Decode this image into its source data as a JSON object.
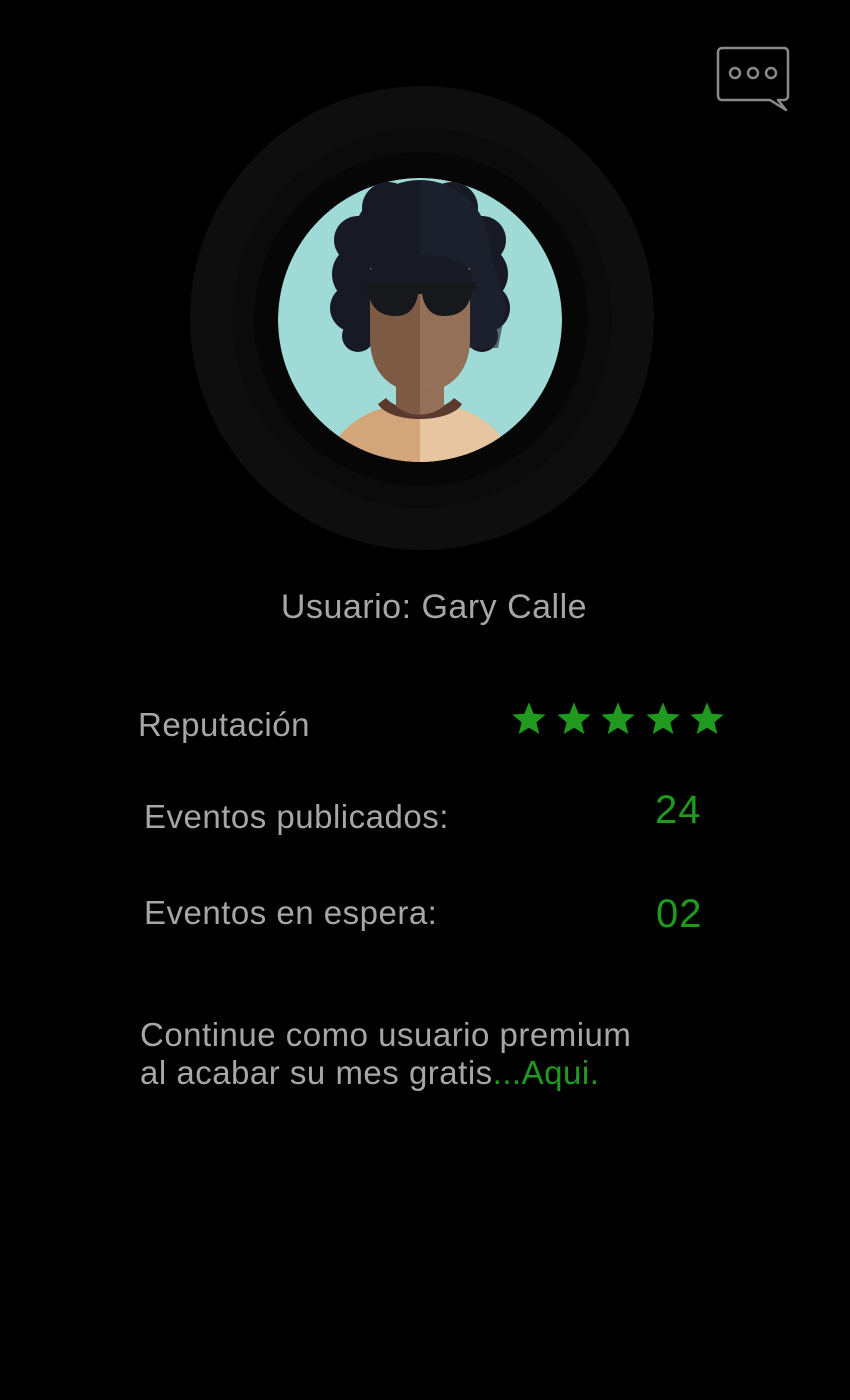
{
  "header": {
    "chat_icon": "chat-bubble-ellipsis-icon"
  },
  "profile": {
    "avatar_icon": "user-avatar-afro-sunglasses",
    "username_label": "Usuario: Gary Calle"
  },
  "stats": {
    "reputation_label": "Reputación",
    "reputation_stars": 5,
    "reputation_max": 5,
    "star_icon": "star-icon",
    "published_label": "Eventos publicados:",
    "published_value": "24",
    "waiting_label": "Eventos en espera:",
    "waiting_value": "02"
  },
  "premium": {
    "line1": "Continue como usuario premium",
    "line2": "al acabar su mes gratis",
    "link_text": "...Aqui."
  },
  "colors": {
    "background": "#000000",
    "text": "#a6a6a6",
    "accent": "#1f9a1f",
    "avatar_bg": "#9fdad6"
  }
}
